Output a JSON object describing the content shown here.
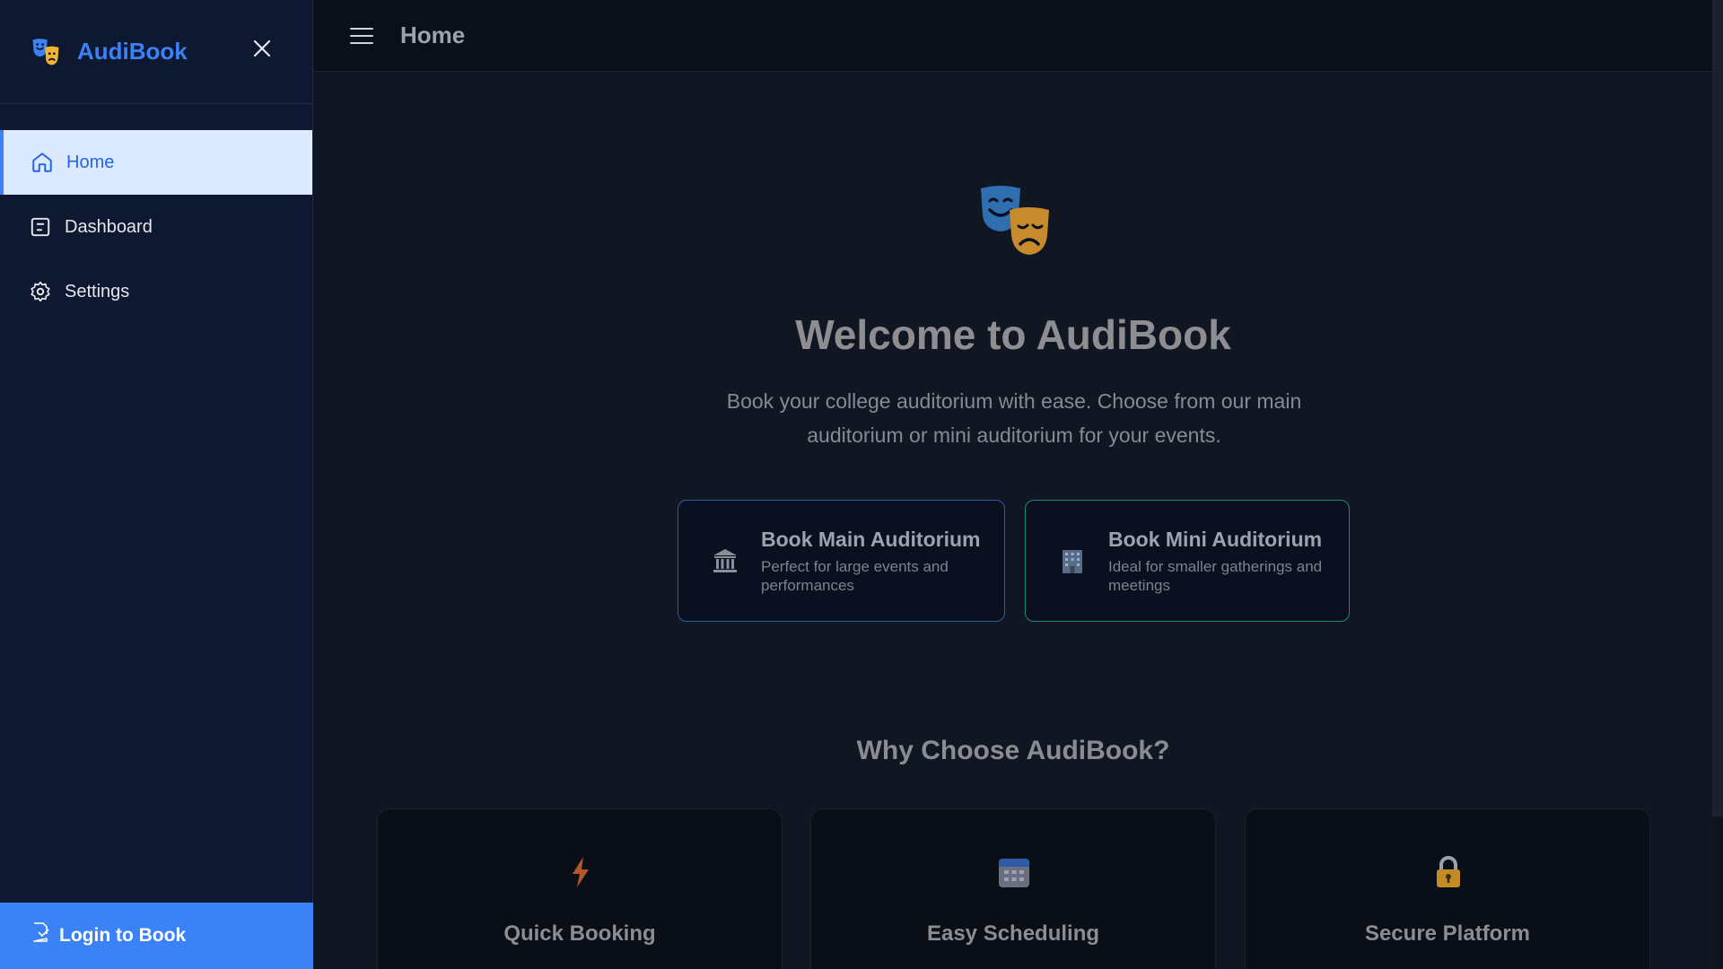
{
  "sidebar": {
    "brand": "AudiBook",
    "items": [
      {
        "label": "Home",
        "icon": "home-icon",
        "active": true
      },
      {
        "label": "Dashboard",
        "icon": "dashboard-icon",
        "active": false
      },
      {
        "label": "Settings",
        "icon": "gear-icon",
        "active": false
      }
    ],
    "login_label": "Login to Book"
  },
  "topbar": {
    "title": "Home"
  },
  "hero": {
    "title": "Welcome to AudiBook",
    "subtitle": "Book your college auditorium with ease. Choose from our main auditorium or mini auditorium for your events."
  },
  "booking": [
    {
      "title": "Book Main Auditorium",
      "description": "Perfect for large events and performances",
      "icon": "classical-building-icon"
    },
    {
      "title": "Book Mini Auditorium",
      "description": "Ideal for smaller gatherings and meetings",
      "icon": "office-building-icon"
    }
  ],
  "why": {
    "title": "Why Choose AudiBook?",
    "features": [
      {
        "title": "Quick Booking",
        "icon": "lightning-icon"
      },
      {
        "title": "Easy Scheduling",
        "icon": "calendar-icon"
      },
      {
        "title": "Secure Platform",
        "icon": "lock-icon"
      }
    ]
  },
  "colors": {
    "accent": "#3b82f6",
    "sidebar_bg": "#0e1830",
    "main_bg": "#111722",
    "main_card_border": "#2f5aa8",
    "mini_card_border": "#1f8a72"
  }
}
